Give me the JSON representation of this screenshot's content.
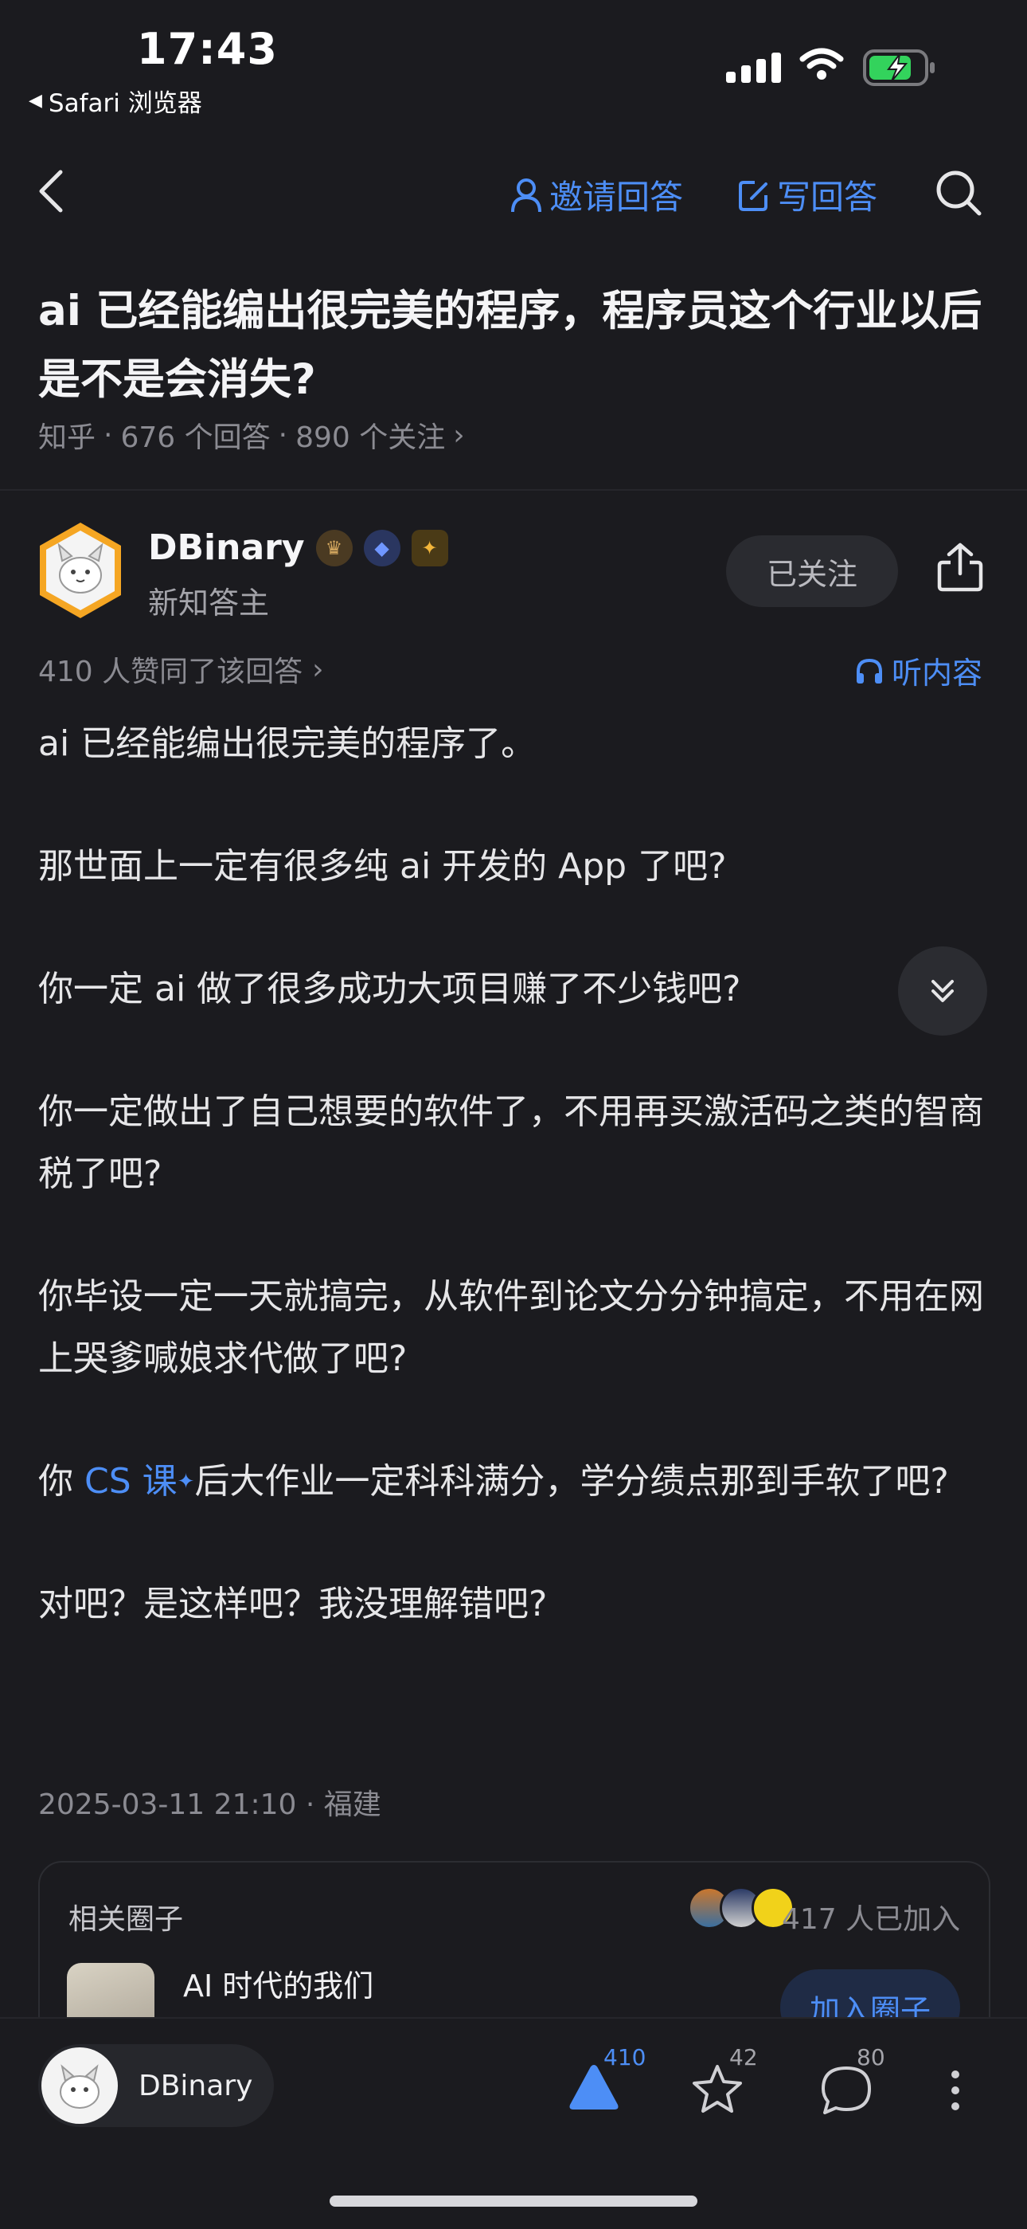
{
  "status_bar": {
    "time": "17:43",
    "back_app": "Safari 浏览器"
  },
  "nav": {
    "invite_label": "邀请回答",
    "write_label": "写回答"
  },
  "question": {
    "title": "ai 已经能编出很完美的程序，程序员这个行业以后是不是会消失?",
    "source": "知乎",
    "answers": "676 个回答",
    "followers": "890 个关注"
  },
  "author": {
    "name": "DBinary",
    "subtitle": "新知答主",
    "follow_label": "已关注"
  },
  "answer": {
    "likes_line": "410 人赞同了该回答",
    "listen_label": "听内容",
    "paragraphs": [
      "ai 已经能编出很完美的程序了。",
      "那世面上一定有很多纯 ai 开发的 App 了吧?",
      "你一定 ai 做了很多成功大项目赚了不少钱吧?",
      "你一定做出了自己想要的软件了，不用再买激活码之类的智商税了吧?",
      "你毕设一定一天就搞完，从软件到论文分分钟搞定，不用在网上哭爹喊娘求代做了吧?"
    ],
    "p6_prefix": "你 ",
    "p6_link": "CS 课",
    "p6_suffix": "后大作业一定科科满分，学分绩点那到手软了吧?",
    "p7": "对吧？是这样吧？我没理解错吧?",
    "date_line": "2025-03-11 21:10 · 福建"
  },
  "circle_card": {
    "title": "相关圈子",
    "joined": "417 人已加入",
    "name": "AI 时代的我们",
    "join_label": "加入圈子"
  },
  "bottom_bar": {
    "user_name": "DBinary",
    "upvotes": "410",
    "favorites": "42",
    "comments": "80"
  },
  "colors": {
    "accent": "#4d8ef6",
    "background": "#1b1b1f"
  }
}
